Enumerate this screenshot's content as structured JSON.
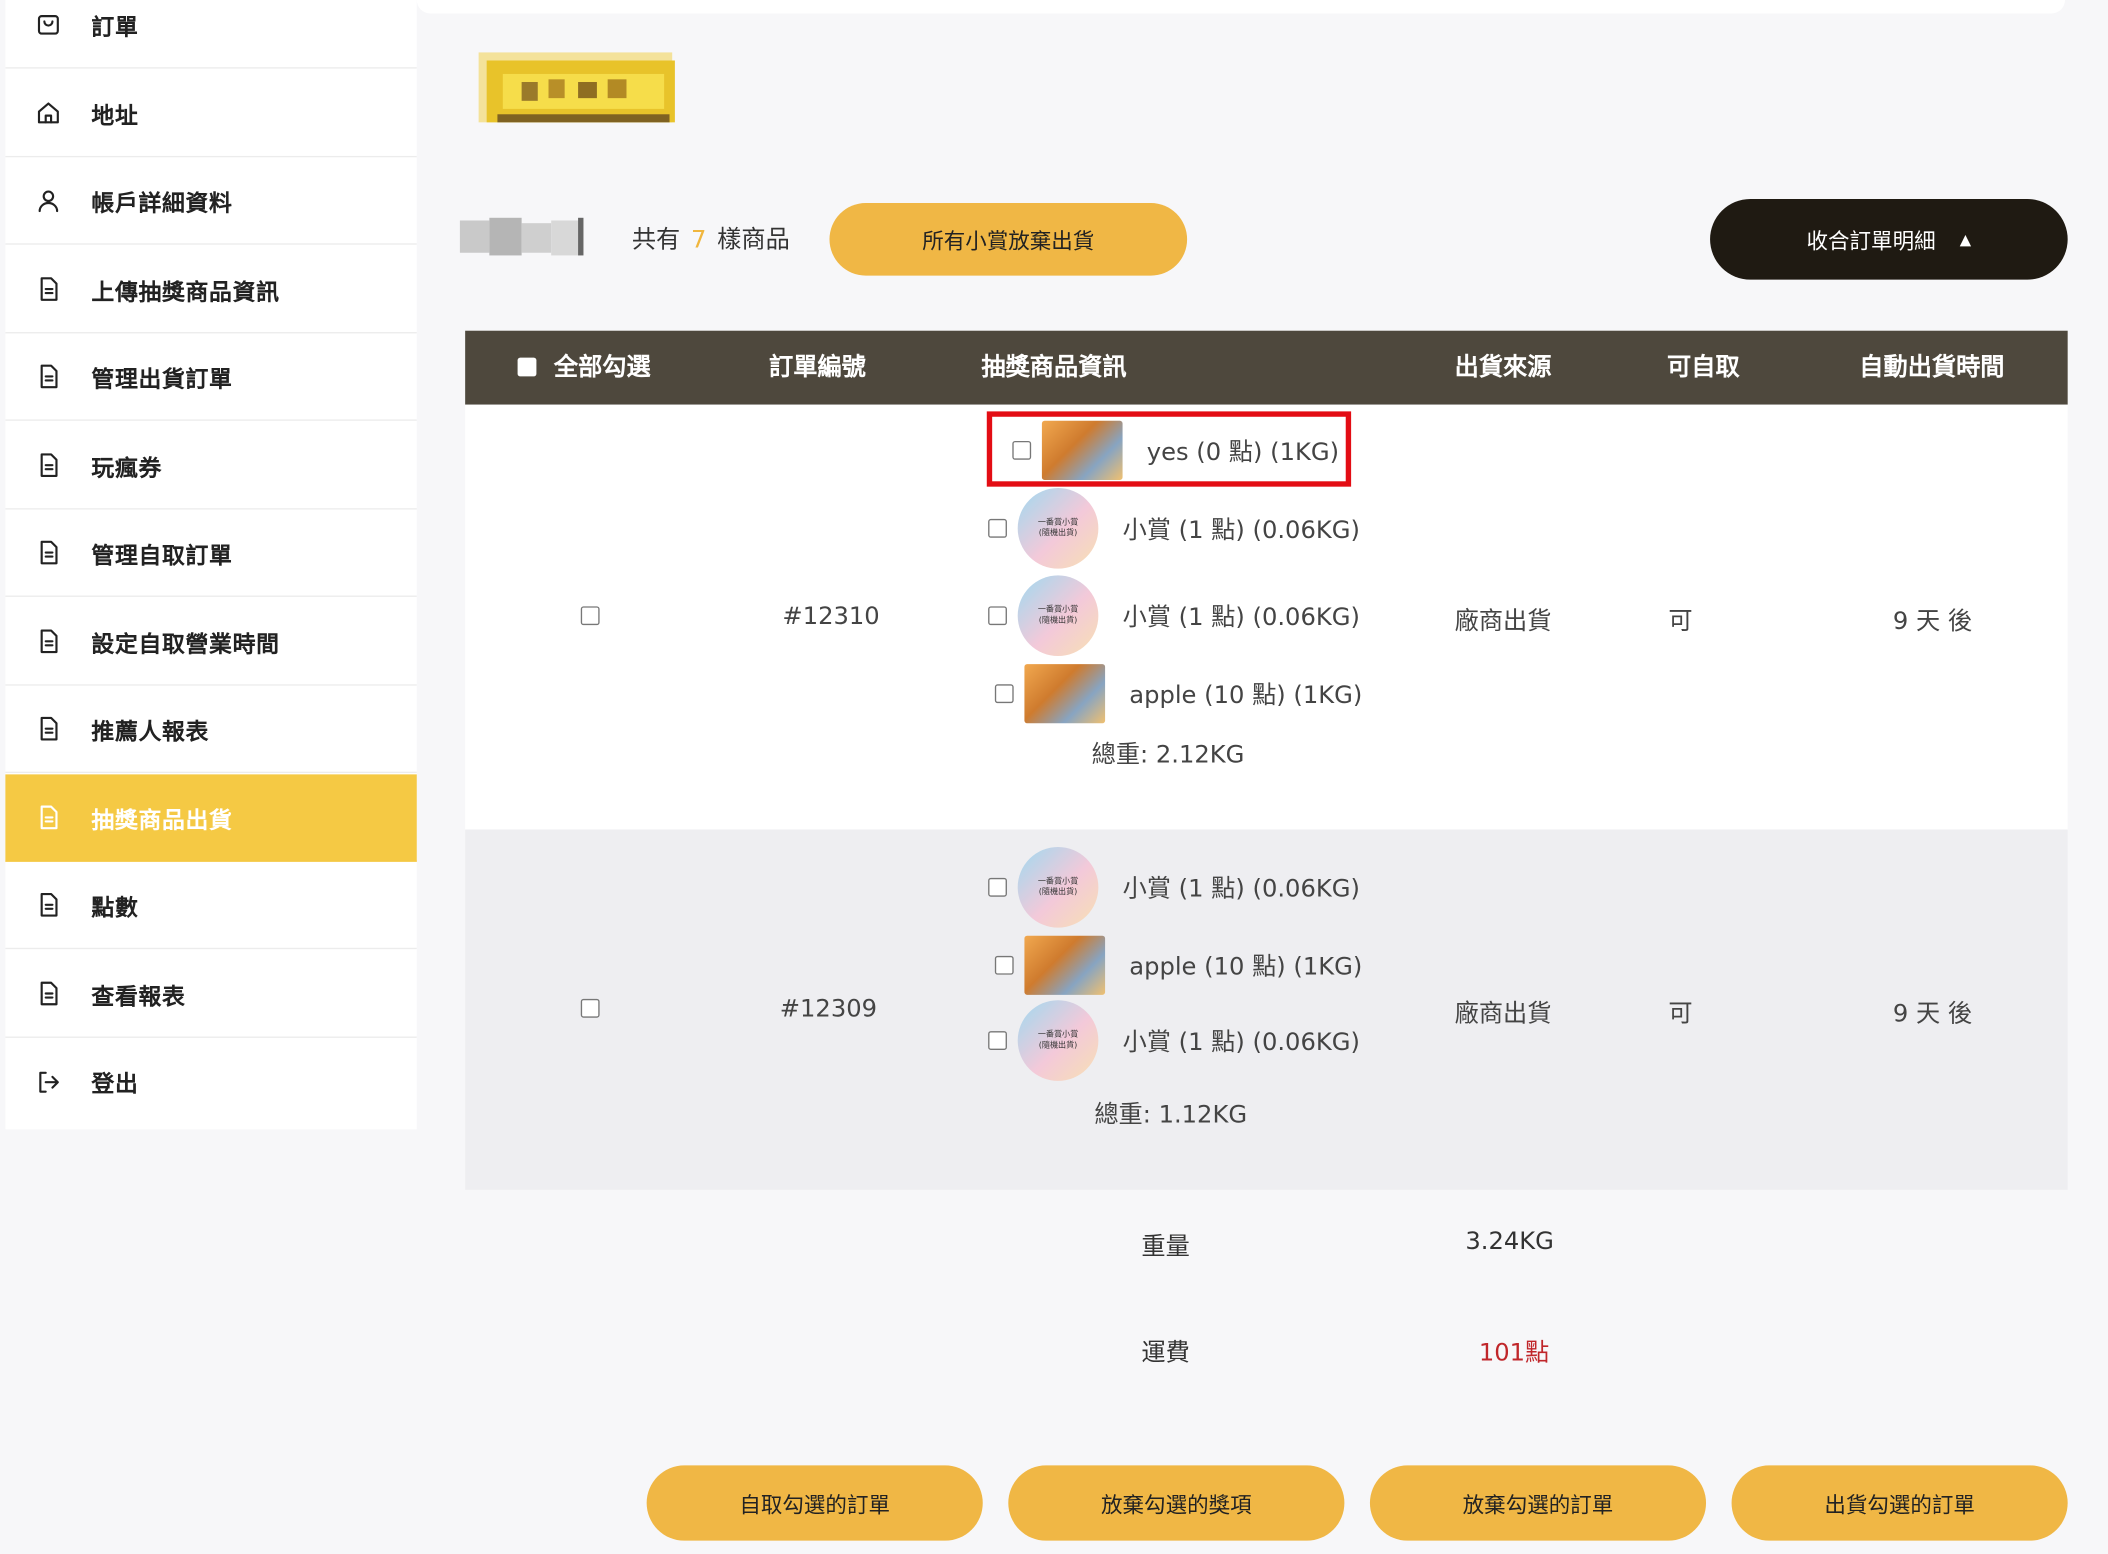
{
  "sidebar": {
    "items": [
      {
        "label": "訂單",
        "icon": "shopping-bag-icon"
      },
      {
        "label": "地址",
        "icon": "home-icon"
      },
      {
        "label": "帳戶詳細資料",
        "icon": "user-icon"
      },
      {
        "label": "上傳抽獎商品資訊",
        "icon": "document-icon"
      },
      {
        "label": "管理出貨訂單",
        "icon": "document-icon"
      },
      {
        "label": "玩瘋券",
        "icon": "document-icon"
      },
      {
        "label": "管理自取訂單",
        "icon": "document-icon"
      },
      {
        "label": "設定自取營業時間",
        "icon": "document-icon"
      },
      {
        "label": "推薦人報表",
        "icon": "document-icon"
      },
      {
        "label": "抽獎商品出貨",
        "icon": "document-icon",
        "active": true
      },
      {
        "label": "點數",
        "icon": "document-icon"
      },
      {
        "label": "查看報表",
        "icon": "document-icon"
      },
      {
        "label": "登出",
        "icon": "logout-icon"
      }
    ]
  },
  "summary": {
    "prefix": "共有",
    "count": "7",
    "suffix": "樣商品"
  },
  "buttons": {
    "abandon_all": "所有小賞放棄出貨",
    "collapse": "收合訂單明細",
    "pickup_selected": "自取勾選的訂單",
    "abandon_selected_prizes": "放棄勾選的獎項",
    "abandon_selected_orders": "放棄勾選的訂單",
    "ship_selected": "出貨勾選的訂單"
  },
  "table": {
    "headers": {
      "select_all": "全部勾選",
      "order_no": "訂單編號",
      "prize_info": "抽獎商品資訊",
      "ship_source": "出貨來源",
      "self_pickup": "可自取",
      "auto_ship_time": "自動出貨時間"
    },
    "rows": [
      {
        "order_no": "#12310",
        "items": [
          {
            "name": "yes (0 點) (1KG)",
            "thumb": "photo"
          },
          {
            "name": "小賞 (1 點) (0.06KG)",
            "thumb": "circle"
          },
          {
            "name": "小賞 (1 點) (0.06KG)",
            "thumb": "circle"
          },
          {
            "name": "apple (10 點) (1KG)",
            "thumb": "photo"
          }
        ],
        "total_weight": "總重: 2.12KG",
        "ship_source": "廠商出貨",
        "self_pickup": "可",
        "auto_ship_time": "9 天 後"
      },
      {
        "order_no": "#12309",
        "items": [
          {
            "name": "小賞 (1 點) (0.06KG)",
            "thumb": "circle"
          },
          {
            "name": "apple (10 點) (1KG)",
            "thumb": "photo"
          },
          {
            "name": "小賞 (1 點) (0.06KG)",
            "thumb": "circle"
          }
        ],
        "total_weight": "總重: 1.12KG",
        "ship_source": "廠商出貨",
        "self_pickup": "可",
        "auto_ship_time": "9 天 後"
      }
    ]
  },
  "totals": {
    "weight_label": "重量",
    "weight_value": "3.24KG",
    "shipping_label": "運費",
    "shipping_value": "101點"
  },
  "thumb_text": {
    "line1": "一番賞小賞",
    "line2": "(隨機出貨)"
  },
  "colors": {
    "accent": "#f0b745",
    "active_nav": "#f5c944",
    "header_bg": "#4e483d",
    "dark_button": "#1f1a12",
    "shipping_fee": "#c0262a",
    "highlight": "#e30d14"
  }
}
